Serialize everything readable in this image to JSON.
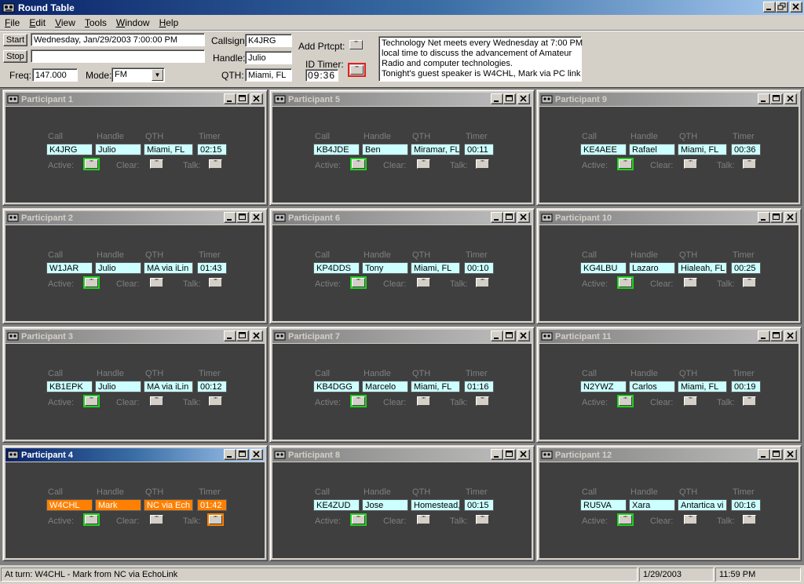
{
  "window": {
    "title": "Round Table"
  },
  "menu": [
    {
      "label": "File",
      "key": "F",
      "rest": "ile"
    },
    {
      "label": "Edit",
      "key": "E",
      "rest": "dit"
    },
    {
      "label": "View",
      "key": "V",
      "rest": "iew"
    },
    {
      "label": "Tools",
      "key": "T",
      "rest": "ools"
    },
    {
      "label": "Window",
      "key": "W",
      "rest": "indow"
    },
    {
      "label": "Help",
      "key": "H",
      "rest": "elp"
    }
  ],
  "controls": {
    "start_label": "Start",
    "stop_label": "Stop",
    "start_time": "Wednesday, Jan/29/2003 7:00:00 PM",
    "stop_time": "",
    "freq_label": "Freq:",
    "freq": "147.000",
    "mode_label": "Mode:",
    "mode": "FM",
    "callsign_label": "Callsign:",
    "callsign": "K4JRG",
    "handle_label": "Handle:",
    "handle": "Julio",
    "qth_label": "QTH:",
    "qth": "Miami, FL",
    "add_label": "Add Prtcpt:",
    "id_timer_label": "ID Timer:",
    "id_timer": "09:36",
    "notes": [
      "Technology Net meets every Wednesday at 7:00 PM",
      "local time to discuss the advancement of Amateur",
      "Radio and computer technologies.",
      "Tonight's guest speaker is W4CHL, Mark via PC link"
    ]
  },
  "labels": {
    "call": "Call",
    "handle": "Handle",
    "qth": "QTH",
    "timer": "Timer",
    "active": "Active:",
    "clear": "Clear:",
    "talk": "Talk:"
  },
  "participants": [
    {
      "title": "Participant 1",
      "call": "K4JRG",
      "handle": "Julio",
      "qth": "Miami, FL",
      "timer": "02:15"
    },
    {
      "title": "Participant 2",
      "call": "W1JAR",
      "handle": "Julio",
      "qth": "MA via iLin",
      "timer": "01:43"
    },
    {
      "title": "Participant 3",
      "call": "KB1EPK",
      "handle": "Julio",
      "qth": "MA via iLin",
      "timer": "00:12"
    },
    {
      "title": "Participant 4",
      "call": "W4CHL",
      "handle": "Mark",
      "qth": "NC via Ech",
      "timer": "01:42"
    },
    {
      "title": "Participant 5",
      "call": "KB4JDE",
      "handle": "Ben",
      "qth": "Miramar, FL",
      "timer": "00:11"
    },
    {
      "title": "Participant 6",
      "call": "KP4DDS",
      "handle": "Tony",
      "qth": "Miami, FL",
      "timer": "00:10"
    },
    {
      "title": "Participant 7",
      "call": "KB4DGG",
      "handle": "Marcelo",
      "qth": "Miami, FL",
      "timer": "01:16"
    },
    {
      "title": "Participant 8",
      "call": "KE4ZUD",
      "handle": "Jose",
      "qth": "Homestead,",
      "timer": "00:15"
    },
    {
      "title": "Participant 9",
      "call": "KE4AEE",
      "handle": "Rafael",
      "qth": "Miami, FL",
      "timer": "00:36"
    },
    {
      "title": "Participant 10",
      "call": "KG4LBU",
      "handle": "Lazaro",
      "qth": "Hialeah, FL",
      "timer": "00:25"
    },
    {
      "title": "Participant 11",
      "call": "N2YWZ",
      "handle": "Carlos",
      "qth": "Miami, FL",
      "timer": "00:19"
    },
    {
      "title": "Participant 12",
      "call": "RU5VA",
      "handle": "Xara",
      "qth": "Antartica vi",
      "timer": "00:16"
    }
  ],
  "status": {
    "message": "At turn: W4CHL - Mark from NC via EchoLink",
    "date": "1/29/2003",
    "time": "11:59 PM"
  }
}
